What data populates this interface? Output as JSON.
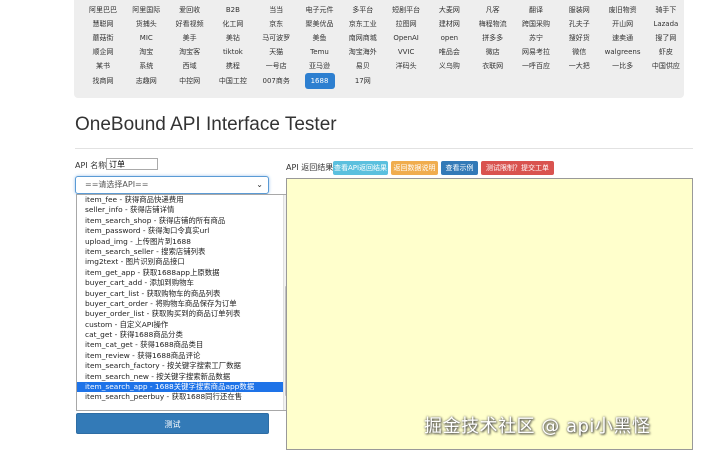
{
  "platforms": {
    "rows": [
      [
        "阿里巴巴",
        "阿里国际",
        "爱回收",
        "B2B",
        "当当",
        "电子元件",
        "多平台",
        "短剧平台",
        "大麦网",
        "凡客",
        "翻译",
        "服装网",
        "废旧物资",
        "骑手下"
      ],
      [
        "慧聪网",
        "货捕头",
        "好看视频",
        "化工网",
        "京东",
        "聚美优品",
        "京东工业",
        "拉图网",
        "建材网",
        "梅程物流",
        "跨国采购",
        "孔夫子",
        "开山网",
        "Lazada"
      ],
      [
        "蘑菇街",
        "MIC",
        "美手",
        "美钻",
        "马可波罗",
        "美鱼",
        "南网商城",
        "OpenAI",
        "open",
        "拼多多",
        "苏宁",
        "搜好货",
        "速卖通",
        "搜了网"
      ],
      [
        "顺企网",
        "淘宝",
        "淘宝客",
        "tiktok",
        "天猫",
        "Temu",
        "淘宝海外",
        "VVIC",
        "唯品会",
        "微店",
        "网易考拉",
        "微信",
        "walgreens",
        "虾皮"
      ],
      [
        "某书",
        "系统",
        "西域",
        "携程",
        "一号店",
        "亚马逊",
        "易贝",
        "洋码头",
        "义乌购",
        "衣联网",
        "一呼百应",
        "一大把",
        "一比多",
        "中国供应"
      ],
      [
        "找商网",
        "志趣网",
        "中控网",
        "中国工控",
        "007商务",
        "1688",
        "17网"
      ]
    ],
    "active": "1688"
  },
  "page_title": "OneBound API Interface Tester",
  "form": {
    "api_name_label": "API 名称",
    "api_name_value": "订单",
    "select_value": "==请选择API==",
    "options": [
      "item_fee - 获得商品快递费用",
      "seller_info - 获得店铺详情",
      "item_search_shop - 获得店铺的所有商品",
      "item_password - 获得淘口令真实url",
      "upload_img - 上传图片到1688",
      "item_search_seller - 搜索店铺列表",
      "img2text - 图片识别商品接口",
      "item_get_app - 获取1688app上原数据",
      "buyer_cart_add - 添加到购物车",
      "buyer_cart_list - 获取购物车的商品列表",
      "buyer_cart_order - 将购物车商品保存为订单",
      "buyer_order_list - 获取购买到的商品订单列表",
      "custom - 自定义API操作",
      "cat_get - 获得1688商品分类",
      "item_cat_get - 获得1688商品类目",
      "item_review - 获得1688商品评论",
      "item_search_factory - 按关键字搜索工厂数据",
      "item_search_new - 按关键字搜索新品数据",
      "item_search_app - 1688关键字搜索商品app数据",
      "item_search_peerbuy - 获取1688同行还在售"
    ],
    "selected_option": "item_search_app - 1688关键字搜索商品app数据",
    "test_button": "测试"
  },
  "results": {
    "label": "API 返回结果",
    "buttons": [
      "查看API返回结果",
      "返回数据说明",
      "查看示例",
      "测试限制？提交工单"
    ]
  },
  "watermark": "掘金技术社区 @ api小黑怪",
  "colors": {
    "accent": "#337ab7",
    "selected_option_bg": "#1e73e8",
    "result_bg": "#ffffcc",
    "btn_info": "#5bc0de",
    "btn_warning": "#f0ad4e",
    "btn_danger": "#d9534f"
  },
  "icons": {
    "select_caret": "chevron-down-icon"
  }
}
